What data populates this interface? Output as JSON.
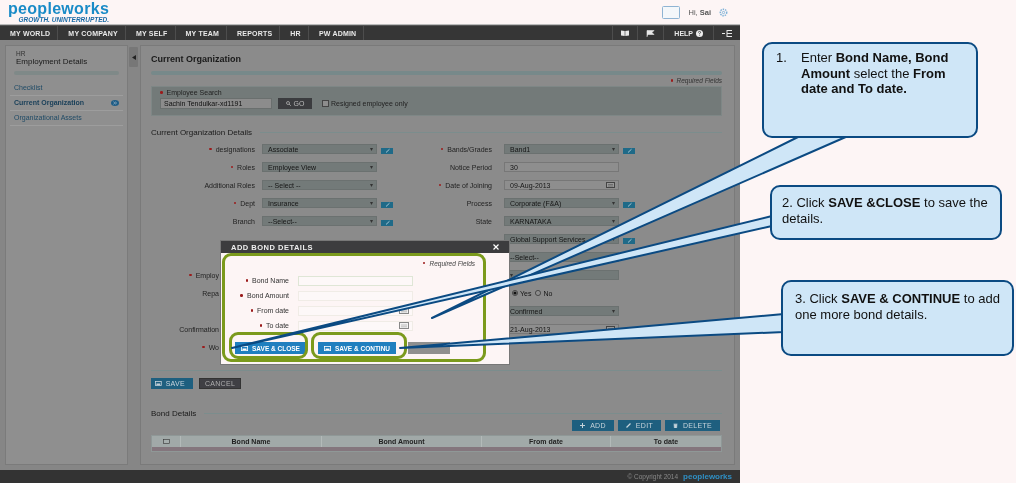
{
  "header": {
    "logo": "peopleworks",
    "tagline": "GROWTH. UNINTERRUPTED.",
    "greeting": "Hi, **Sai**"
  },
  "nav": {
    "items": [
      "MY WORLD",
      "MY COMPANY",
      "MY SELF",
      "MY TEAM",
      "REPORTS",
      "HR",
      "PW ADMIN"
    ],
    "help": "HELP"
  },
  "sidebar": {
    "section": "HR",
    "title": "Employment Details",
    "items": [
      {
        "label": "Checklist",
        "selected": false
      },
      {
        "label": "Current Organization",
        "selected": true
      },
      {
        "label": "Organizational Assets",
        "selected": false
      }
    ]
  },
  "page": {
    "title": "Current Organization",
    "required_note": "Required Fields"
  },
  "search": {
    "label": "Employee Search",
    "value": "Sachin Tendulkar-xd1191",
    "button": "GO",
    "checkbox_label": "Resigned employee only",
    "checked": false
  },
  "details": {
    "title": "Current Organization Details",
    "left": [
      {
        "label": "designations",
        "required": true,
        "kind": "select",
        "value": "Associate",
        "editable": true
      },
      {
        "label": "Roles",
        "required": true,
        "kind": "select",
        "value": "Employee View",
        "editable": false
      },
      {
        "label": "Additional Roles",
        "required": false,
        "kind": "select",
        "value": "-- Select --",
        "editable": false
      },
      {
        "label": "Dept",
        "required": true,
        "kind": "select",
        "value": "Insurance",
        "editable": true
      },
      {
        "label": "Branch",
        "required": false,
        "kind": "select",
        "value": "--Select--",
        "editable": true
      },
      {
        "kind": "covered"
      },
      {
        "kind": "covered"
      },
      {
        "label": "Employ",
        "required": true,
        "kind": "covered"
      },
      {
        "label": "Repa",
        "required": false,
        "kind": "covered"
      },
      {
        "kind": "covered"
      },
      {
        "label": "Confirmation",
        "required": false,
        "kind": "covered"
      },
      {
        "label": "Wo",
        "required": true,
        "kind": "covered"
      }
    ],
    "right": [
      {
        "label": "Bands/Grades",
        "required": true,
        "kind": "select",
        "value": "Band1",
        "editable": true
      },
      {
        "label": "Notice Period",
        "required": false,
        "kind": "input",
        "value": "30",
        "editable": false
      },
      {
        "label": "Date of Joining",
        "required": true,
        "kind": "date",
        "value": "09-Aug-2013",
        "editable": false
      },
      {
        "label": "Process",
        "required": false,
        "kind": "select",
        "value": "Corporate (F&A)",
        "editable": true
      },
      {
        "label": "State",
        "required": false,
        "kind": "select",
        "value": "KARNATAKA",
        "editable": false
      },
      {
        "kind": "select",
        "value": "Global Support Services",
        "editable": true
      },
      {
        "kind": "select",
        "value": "--Select--",
        "editable": false
      },
      {
        "kind": "select",
        "editable": false
      },
      {
        "kind": "radio",
        "options": [
          {
            "label": "Yes",
            "selected": true
          },
          {
            "label": "No",
            "selected": false
          }
        ]
      },
      {
        "kind": "select",
        "value": "Confirmed",
        "editable": false
      },
      {
        "kind": "date",
        "value": "21-Aug-2013",
        "editable": false
      }
    ]
  },
  "form_buttons": [
    {
      "label": "SAVE",
      "kind": "primary"
    },
    {
      "label": "CANCEL",
      "kind": "secondary"
    }
  ],
  "bond_section": {
    "title": "Bond Details",
    "buttons": [
      {
        "label": "ADD",
        "kind": "add"
      },
      {
        "label": "EDIT",
        "kind": "edit"
      },
      {
        "label": "DELETE",
        "kind": "delete"
      }
    ],
    "select_all_checked": false,
    "columns": [
      "Bond Name",
      "Bond Amount",
      "From date",
      "To date"
    ]
  },
  "footer": {
    "copyright": "© Copyright 2014",
    "logo": "peopleworks"
  },
  "modal": {
    "title": "ADD BOND DETAILS",
    "required_note": "Required Fields",
    "fields": [
      {
        "label": "Bond Name",
        "required": true,
        "kind": "text"
      },
      {
        "label": "Bond Amount",
        "required": true,
        "kind": "text"
      },
      {
        "label": "From date",
        "required": true,
        "kind": "date"
      },
      {
        "label": "To date",
        "required": true,
        "kind": "date"
      }
    ],
    "buttons": [
      {
        "label": "SAVE & CLOSE",
        "kind": "primary"
      },
      {
        "label": "SAVE & CONTINU",
        "kind": "primary"
      },
      {
        "kind": "secondary"
      }
    ]
  },
  "callouts": [
    {
      "number": "1.",
      "text": "Enter **Bond Name, Bond Amount** select the **From date and To date.**"
    },
    {
      "text": "2. Click **SAVE &CLOSE** to save the details."
    },
    {
      "text": "3. Click **SAVE & CONTINUE** to add one more bond details."
    }
  ]
}
